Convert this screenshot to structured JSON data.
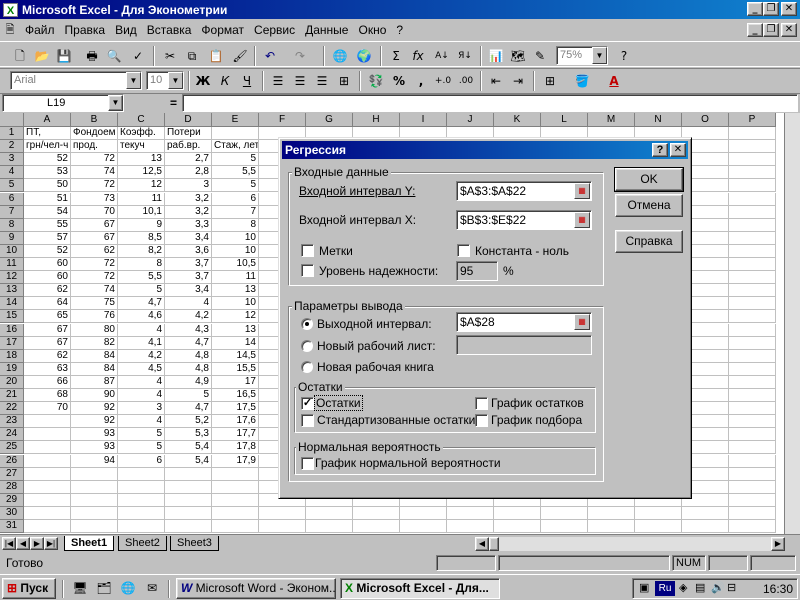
{
  "window": {
    "title": "Microsoft Excel - Для Эконометрии"
  },
  "menu": [
    "Файл",
    "Правка",
    "Вид",
    "Вставка",
    "Формат",
    "Сервис",
    "Данные",
    "Окно",
    "?"
  ],
  "toolbar": {
    "font": "Arial",
    "size": "10",
    "zoom": "75%",
    "bold": "Ж",
    "italic": "К",
    "underline": "Ч",
    "sigma": "Σ",
    "fx": "fx",
    "percent": "%",
    "comma": ","
  },
  "formula_bar": {
    "name_box": "L19",
    "equals": "="
  },
  "columns": [
    "A",
    "B",
    "C",
    "D",
    "E",
    "F",
    "G",
    "H",
    "I",
    "J",
    "K",
    "L",
    "M",
    "N",
    "O",
    "P"
  ],
  "rows": [
    "1",
    "2",
    "3",
    "4",
    "5",
    "6",
    "7",
    "8",
    "9",
    "10",
    "11",
    "12",
    "13",
    "14",
    "15",
    "16",
    "17",
    "18",
    "19",
    "20",
    "21",
    "22",
    "23",
    "24",
    "25",
    "26",
    "27",
    "28",
    "29",
    "30",
    "31"
  ],
  "headers": {
    "row1": [
      "ПТ,",
      "Фондоем",
      "Коэфф.",
      "Потери",
      ""
    ],
    "row2": [
      "грн/чел-ч",
      "прод.",
      "текуч",
      "раб.вр.",
      "Стаж, лет"
    ]
  },
  "table": [
    [
      "52",
      "72",
      "13",
      "2,7",
      "5"
    ],
    [
      "53",
      "74",
      "12,5",
      "2,8",
      "5,5"
    ],
    [
      "50",
      "72",
      "12",
      "3",
      "5"
    ],
    [
      "51",
      "73",
      "11",
      "3,2",
      "6"
    ],
    [
      "54",
      "70",
      "10,1",
      "3,2",
      "7"
    ],
    [
      "55",
      "67",
      "9",
      "3,3",
      "8"
    ],
    [
      "57",
      "67",
      "8,5",
      "3,4",
      "10"
    ],
    [
      "52",
      "62",
      "8,2",
      "3,6",
      "10"
    ],
    [
      "60",
      "72",
      "8",
      "3,7",
      "10,5"
    ],
    [
      "60",
      "72",
      "5,5",
      "3,7",
      "11"
    ],
    [
      "62",
      "74",
      "5",
      "3,4",
      "13"
    ],
    [
      "64",
      "75",
      "4,7",
      "4",
      "10"
    ],
    [
      "65",
      "76",
      "4,6",
      "4,2",
      "12"
    ],
    [
      "67",
      "80",
      "4",
      "4,3",
      "13"
    ],
    [
      "67",
      "82",
      "4,1",
      "4,7",
      "14"
    ],
    [
      "62",
      "84",
      "4,2",
      "4,8",
      "14,5"
    ],
    [
      "63",
      "84",
      "4,5",
      "4,8",
      "15,5"
    ],
    [
      "66",
      "87",
      "4",
      "4,9",
      "17"
    ],
    [
      "68",
      "90",
      "4",
      "5",
      "16,5"
    ],
    [
      "70",
      "92",
      "3",
      "4,7",
      "17,5"
    ],
    [
      "",
      "92",
      "4",
      "5,2",
      "17,6"
    ],
    [
      "",
      "93",
      "5",
      "5,3",
      "17,7"
    ],
    [
      "",
      "93",
      "5",
      "5,4",
      "17,8"
    ],
    [
      "",
      "94",
      "6",
      "5,4",
      "17,9"
    ]
  ],
  "sheets": [
    "Sheet1",
    "Sheet2",
    "Sheet3"
  ],
  "status": {
    "ready": "Готово",
    "num": "NUM"
  },
  "taskbar": {
    "start": "Пуск",
    "word": "Microsoft Word - Эконом...",
    "excel": "Microsoft Excel - Для...",
    "lang": "Ru",
    "time": "16:30"
  },
  "dialog": {
    "title": "Регрессия",
    "help_q": "?",
    "input_group": "Входные данные",
    "input_y_label": "Входной интервал Y:",
    "input_y_value": "$A$3:$A$22",
    "input_x_label": "Входной интервал X:",
    "input_x_value": "$B$3:$E$22",
    "labels": "Метки",
    "constant_zero": "Константа - ноль",
    "confidence": "Уровень надежности:",
    "confidence_value": "95",
    "percent": "%",
    "output_group": "Параметры вывода",
    "output_range": "Выходной интервал:",
    "output_range_value": "$A$28",
    "new_sheet": "Новый рабочий лист:",
    "new_book": "Новая рабочая книга",
    "residuals_group": "Остатки",
    "residuals": "Остатки",
    "std_residuals": "Стандартизованные остатки",
    "residual_plots": "График остатков",
    "line_fit": "График подбора",
    "normal_group": "Нормальная вероятность",
    "normal_plot": "График нормальной вероятности",
    "ok": "OK",
    "cancel": "Отмена",
    "help": "Справка"
  }
}
